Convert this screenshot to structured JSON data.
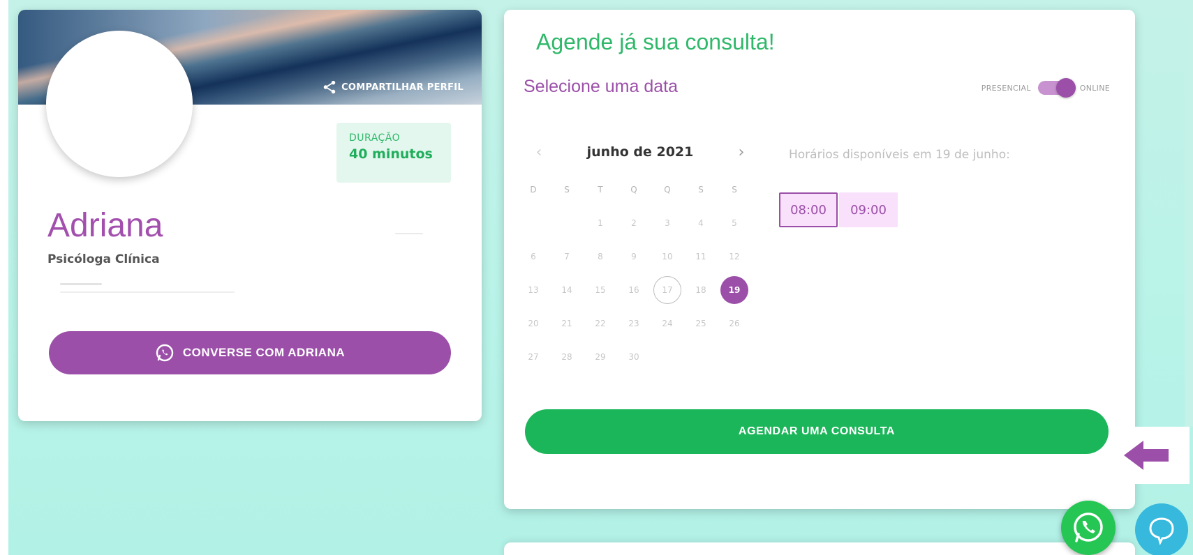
{
  "profile": {
    "share_label": "COMPARTILHAR PERFIL",
    "duration_label": "DURAÇÃO",
    "duration_value": "40 minutos",
    "name": "Adriana",
    "role": "Psicóloga Clínica",
    "chat_button_label": "CONVERSE COM ADRIANA"
  },
  "booking": {
    "title": "Agende já sua consulta!",
    "select_date_label": "Selecione uma data",
    "mode_left": "PRESENCIAL",
    "mode_right": "ONLINE",
    "mode_online_selected": true,
    "month_label": "junho de 2021",
    "prev_arrow": "‹",
    "next_arrow": "›",
    "weekdays": [
      "D",
      "S",
      "T",
      "Q",
      "Q",
      "S",
      "S"
    ],
    "weeks": [
      [
        "",
        "",
        "1",
        "2",
        "3",
        "4",
        "5"
      ],
      [
        "6",
        "7",
        "8",
        "9",
        "10",
        "11",
        "12"
      ],
      [
        "13",
        "14",
        "15",
        "16",
        "17",
        "18",
        "19"
      ],
      [
        "20",
        "21",
        "22",
        "23",
        "24",
        "25",
        "26"
      ],
      [
        "27",
        "28",
        "29",
        "30",
        "",
        "",
        ""
      ]
    ],
    "today_day": "17",
    "selected_day": "19",
    "times_title": "Horários disponíveis em 19 de junho:",
    "slots": [
      "08:00",
      "09:00"
    ],
    "active_slot": "08:00",
    "book_button_label": "AGENDAR UMA CONSULTA"
  },
  "colors": {
    "purple": "#9b4fa8",
    "green": "#1cb65a",
    "light_purple": "#f9e0fb",
    "mint_background": "#b8f3e8"
  },
  "icons": {
    "share": "share-icon",
    "whatsapp": "whatsapp-icon",
    "arrow": "arrow-left-icon",
    "chat": "chat-bubble-icon"
  }
}
